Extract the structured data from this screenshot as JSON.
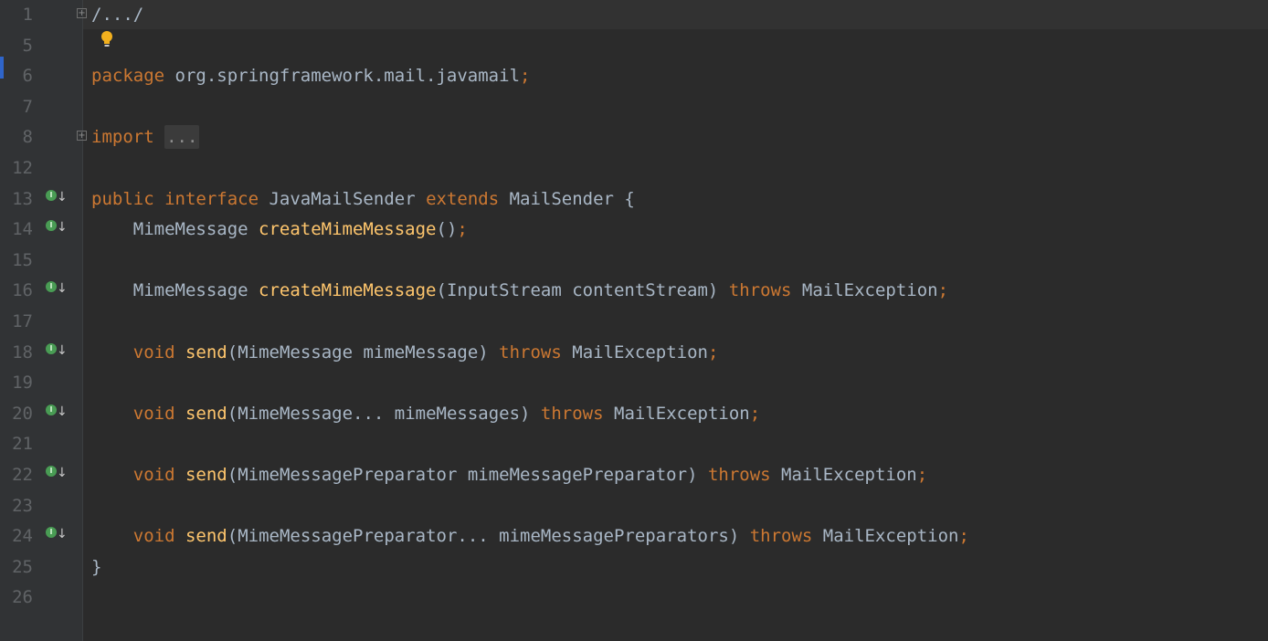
{
  "editor": {
    "accent": "#2f65ca",
    "lines": [
      {
        "no": "1",
        "marker": "fold",
        "tokens": [
          {
            "t": "/.../",
            "c": "folded-plain"
          }
        ]
      },
      {
        "no": "5",
        "marker": "none",
        "tokens": []
      },
      {
        "no": "6",
        "marker": "none",
        "tokens": [
          {
            "t": "package",
            "c": "kw"
          },
          {
            "t": " org.springframework.mail.javamail",
            "c": "pl"
          },
          {
            "t": ";",
            "c": "semi"
          }
        ]
      },
      {
        "no": "7",
        "marker": "none",
        "tokens": []
      },
      {
        "no": "8",
        "marker": "fold",
        "tokens": [
          {
            "t": "import",
            "c": "kw"
          },
          {
            "t": " ",
            "c": "pl"
          },
          {
            "t": "...",
            "c": "folded"
          }
        ]
      },
      {
        "no": "12",
        "marker": "none",
        "tokens": []
      },
      {
        "no": "13",
        "marker": "impl",
        "tokens": [
          {
            "t": "public",
            "c": "kw"
          },
          {
            "t": " ",
            "c": "pl"
          },
          {
            "t": "interface",
            "c": "kw"
          },
          {
            "t": " JavaMailSender ",
            "c": "pl"
          },
          {
            "t": "extends",
            "c": "kw"
          },
          {
            "t": " MailSender {",
            "c": "pl"
          }
        ]
      },
      {
        "no": "14",
        "marker": "impl",
        "tokens": [
          {
            "t": "    MimeMessage ",
            "c": "pl"
          },
          {
            "t": "createMimeMessage",
            "c": "fn"
          },
          {
            "t": "()",
            "c": "pl"
          },
          {
            "t": ";",
            "c": "semi"
          }
        ]
      },
      {
        "no": "15",
        "marker": "none",
        "tokens": []
      },
      {
        "no": "16",
        "marker": "impl",
        "tokens": [
          {
            "t": "    MimeMessage ",
            "c": "pl"
          },
          {
            "t": "createMimeMessage",
            "c": "fn"
          },
          {
            "t": "(InputStream contentStream) ",
            "c": "pl"
          },
          {
            "t": "throws",
            "c": "kw"
          },
          {
            "t": " MailException",
            "c": "pl"
          },
          {
            "t": ";",
            "c": "semi"
          }
        ]
      },
      {
        "no": "17",
        "marker": "none",
        "tokens": []
      },
      {
        "no": "18",
        "marker": "impl",
        "tokens": [
          {
            "t": "    ",
            "c": "pl"
          },
          {
            "t": "void",
            "c": "kw"
          },
          {
            "t": " ",
            "c": "pl"
          },
          {
            "t": "send",
            "c": "fn"
          },
          {
            "t": "(MimeMessage mimeMessage) ",
            "c": "pl"
          },
          {
            "t": "throws",
            "c": "kw"
          },
          {
            "t": " MailException",
            "c": "pl"
          },
          {
            "t": ";",
            "c": "semi"
          }
        ]
      },
      {
        "no": "19",
        "marker": "none",
        "tokens": []
      },
      {
        "no": "20",
        "marker": "impl",
        "tokens": [
          {
            "t": "    ",
            "c": "pl"
          },
          {
            "t": "void",
            "c": "kw"
          },
          {
            "t": " ",
            "c": "pl"
          },
          {
            "t": "send",
            "c": "fn"
          },
          {
            "t": "(MimeMessage... mimeMessages) ",
            "c": "pl"
          },
          {
            "t": "throws",
            "c": "kw"
          },
          {
            "t": " MailException",
            "c": "pl"
          },
          {
            "t": ";",
            "c": "semi"
          }
        ]
      },
      {
        "no": "21",
        "marker": "none",
        "tokens": []
      },
      {
        "no": "22",
        "marker": "impl",
        "tokens": [
          {
            "t": "    ",
            "c": "pl"
          },
          {
            "t": "void",
            "c": "kw"
          },
          {
            "t": " ",
            "c": "pl"
          },
          {
            "t": "send",
            "c": "fn"
          },
          {
            "t": "(MimeMessagePreparator mimeMessagePreparator) ",
            "c": "pl"
          },
          {
            "t": "throws",
            "c": "kw"
          },
          {
            "t": " MailException",
            "c": "pl"
          },
          {
            "t": ";",
            "c": "semi"
          }
        ]
      },
      {
        "no": "23",
        "marker": "none",
        "tokens": []
      },
      {
        "no": "24",
        "marker": "impl",
        "tokens": [
          {
            "t": "    ",
            "c": "pl"
          },
          {
            "t": "void",
            "c": "kw"
          },
          {
            "t": " ",
            "c": "pl"
          },
          {
            "t": "send",
            "c": "fn"
          },
          {
            "t": "(MimeMessagePreparator... mimeMessagePreparators) ",
            "c": "pl"
          },
          {
            "t": "throws",
            "c": "kw"
          },
          {
            "t": " MailException",
            "c": "pl"
          },
          {
            "t": ";",
            "c": "semi"
          }
        ]
      },
      {
        "no": "25",
        "marker": "none",
        "tokens": [
          {
            "t": "}",
            "c": "pl"
          }
        ]
      },
      {
        "no": "26",
        "marker": "none",
        "tokens": []
      }
    ],
    "icons": {
      "implemented": "implemented-method-icon",
      "fold": "fold-toggle-icon",
      "bulb": "lightbulb-icon"
    }
  }
}
